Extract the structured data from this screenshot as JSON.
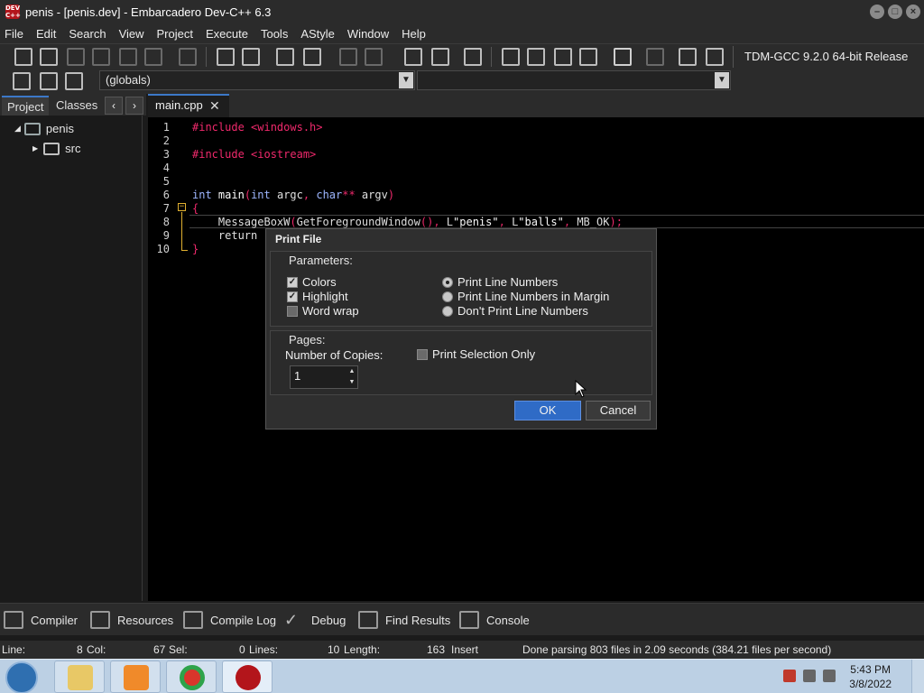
{
  "window": {
    "title": "penis - [penis.dev] - Embarcadero Dev-C++ 6.3",
    "app_icon_text": "DEV C++"
  },
  "menu": [
    "File",
    "Edit",
    "Search",
    "View",
    "Project",
    "Execute",
    "Tools",
    "AStyle",
    "Window",
    "Help"
  ],
  "toolbar": {
    "compiler_select": "TDM-GCC 9.2.0 64-bit Release",
    "scope_select": "(globals)"
  },
  "left_panel": {
    "tabs": [
      "Project",
      "Classes"
    ],
    "prev_arrow": "‹",
    "next_arrow": "›",
    "tree": [
      {
        "label": "penis",
        "icon": "project-icon"
      },
      {
        "label": "src",
        "icon": "folder-icon"
      }
    ]
  },
  "editor": {
    "tab_label": "main.cpp",
    "tab_close": "✕",
    "line_numbers": [
      "1",
      "2",
      "3",
      "4",
      "5",
      "6",
      "7",
      "8",
      "9",
      "10"
    ],
    "lines": [
      "#include <windows.h>",
      "",
      "#include <iostream>",
      "",
      "",
      "int main(int argc, char** argv)",
      "{",
      "    MessageBoxW(GetForegroundWindow(), L\"penis\", L\"balls\", MB_OK);",
      "    return",
      "}"
    ]
  },
  "dialog": {
    "title": "Print File",
    "parameters_label": "Parameters:",
    "colors_label": "Colors",
    "highlight_label": "Highlight",
    "wordwrap_label": "Word wrap",
    "colors_checked": true,
    "highlight_checked": true,
    "wordwrap_checked": false,
    "radio_print_line_numbers": "Print Line Numbers",
    "radio_print_margin": "Print Line Numbers in Margin",
    "radio_dont_print": "Don't Print Line Numbers",
    "selected_radio": "Print Line Numbers",
    "pages_label": "Pages:",
    "copies_label": "Number of Copies:",
    "copies_value": "1",
    "selection_only_label": "Print Selection Only",
    "selection_only_checked": false,
    "ok_label": "OK",
    "cancel_label": "Cancel"
  },
  "bottom_tabs": [
    "Compiler",
    "Resources",
    "Compile Log",
    "Debug",
    "Find Results",
    "Console"
  ],
  "status": {
    "line_label": "Line:",
    "line_value": "8",
    "col_label": "Col:",
    "col_value": "67",
    "sel_label": "Sel:",
    "sel_value": "0",
    "lines_label": "Lines:",
    "lines_value": "10",
    "length_label": "Length:",
    "length_value": "163",
    "mode": "Insert",
    "message": "Done parsing 803 files in 2.09 seconds (384.21 files per second)"
  },
  "taskbar": {
    "time": "5:43 PM",
    "date": "3/8/2022",
    "apps": [
      "file-explorer",
      "media-player",
      "chrome",
      "dev-cpp"
    ]
  }
}
